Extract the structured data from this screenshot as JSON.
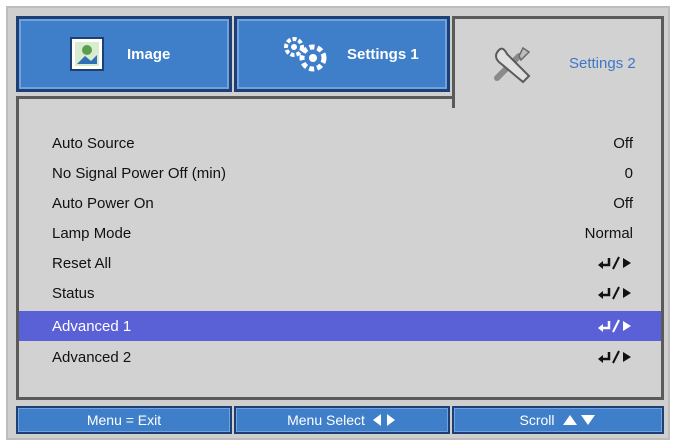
{
  "tabs": [
    {
      "label": "Image",
      "icon": "image-icon",
      "active": false
    },
    {
      "label": "Settings 1",
      "icon": "gears-icon",
      "active": false
    },
    {
      "label": "Settings 2",
      "icon": "tools-icon",
      "active": true
    }
  ],
  "menu": {
    "items": [
      {
        "label": "Auto Source",
        "value": "Off"
      },
      {
        "label": "No Signal Power Off (min)",
        "value": "0"
      },
      {
        "label": "Auto Power On",
        "value": "Off"
      },
      {
        "label": "Lamp Mode",
        "value": "Normal"
      },
      {
        "label": "Reset All",
        "value": "enter-submenu-icon"
      },
      {
        "label": "Status",
        "value": "enter-submenu-icon"
      },
      {
        "label": "Advanced 1",
        "value": "enter-submenu-icon",
        "selected": true
      },
      {
        "label": "Advanced 2",
        "value": "enter-submenu-icon"
      }
    ]
  },
  "footer": {
    "menu_exit": "Menu = Exit",
    "menu_select": "Menu Select",
    "scroll": "Scroll"
  },
  "colors": {
    "tab_blue": "#3f7fc9",
    "tab_border": "#1e3f72",
    "active_tab_text": "#3d78c4",
    "selection": "#5a60d6",
    "background": "#d2d2d2"
  }
}
